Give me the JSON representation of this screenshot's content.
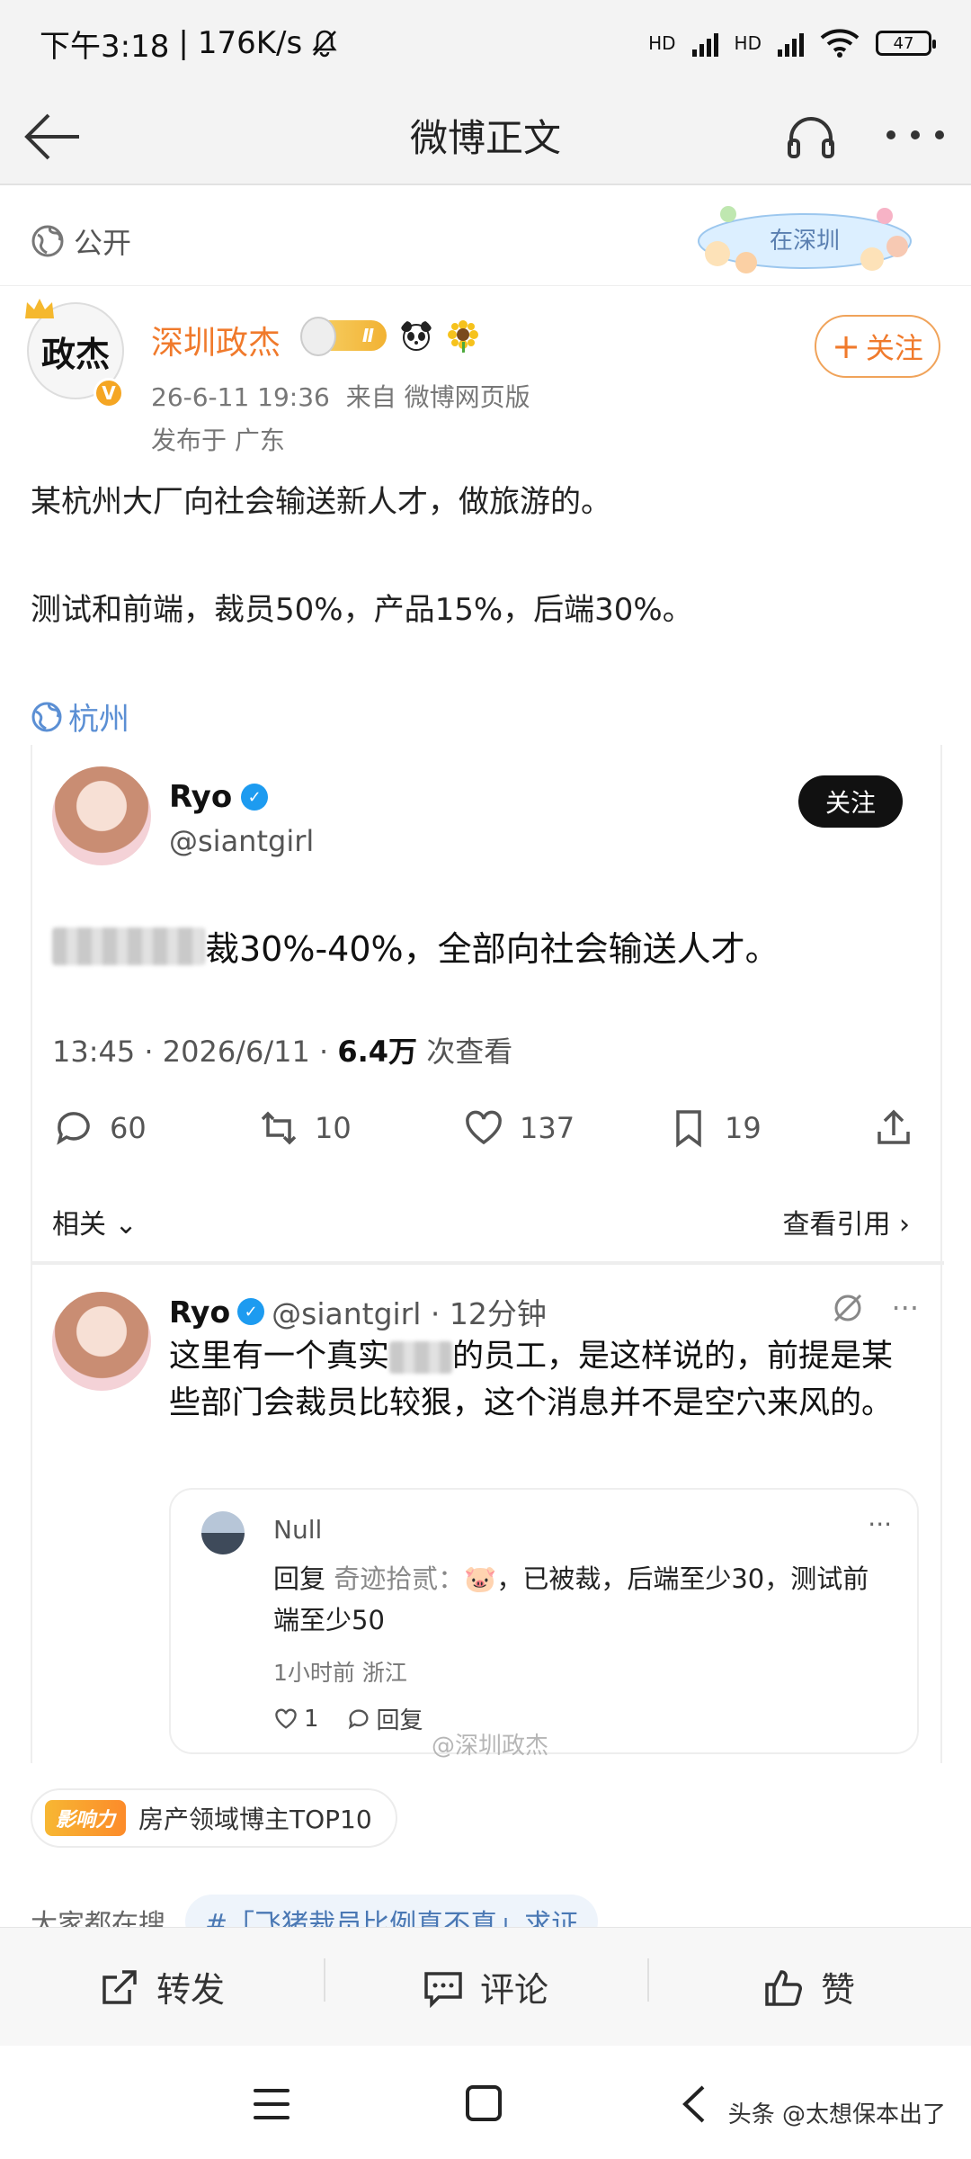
{
  "status": {
    "time": "下午3:18",
    "speed": "176K/s",
    "hd1": "HD",
    "hd2": "HD",
    "battery": "47"
  },
  "nav": {
    "title": "微博正文"
  },
  "visibility": {
    "label": "公开",
    "sticker": "在深圳"
  },
  "author": {
    "avatar_text": "政杰",
    "name": "深圳政杰",
    "level": "Ⅱ",
    "datetime": "26-6-11 19:36",
    "source": "来自 微博网页版",
    "location": "发布于 广东",
    "follow_label": "关注"
  },
  "post": {
    "line1": "某杭州大厂向社会输送新人才，做旅游的。",
    "line2": "测试和前端，裁员50%，产品15%，后端30%。",
    "location_tag": "杭州"
  },
  "tweet": {
    "name": "Ryo",
    "handle": "@siantgirl",
    "follow_label": "关注",
    "text": "裁30%-40%，全部向社会输送人才。",
    "time": "13:45 · 2026/6/11 · ",
    "views": "6.4万",
    "views_suffix": " 次查看",
    "stats": {
      "replies": "60",
      "retweets": "10",
      "likes": "137",
      "bookmarks": "19"
    },
    "related": "相关",
    "view_quotes": "查看引用"
  },
  "reply": {
    "name": "Ryo",
    "handle_time": "@siantgirl · 12分钟",
    "text_before": "这里有一个真实",
    "text_after": "的员工，是这样说的，前提是某些部门会裁员比较狠，这个消息并不是空穴来风的。",
    "quote": {
      "name": "Null",
      "reply_label": "回复",
      "reply_to": "奇迹拾贰：",
      "text": "🐷，已被裁，后端至少30，测试前端至少50",
      "time": "1小时前 浙江",
      "likes": "1",
      "reply_action": "回复"
    },
    "watermark": "@深圳政杰"
  },
  "influence": {
    "tag": "影响力",
    "text": "房产领域博主TOP10"
  },
  "search": {
    "label": "大家都在搜",
    "tag": "#「飞猪裁员比例真不真」求证"
  },
  "bottom": {
    "repost": "转发",
    "comment": "评论",
    "like": "赞"
  },
  "watermark": "头条 @太想保本出了"
}
